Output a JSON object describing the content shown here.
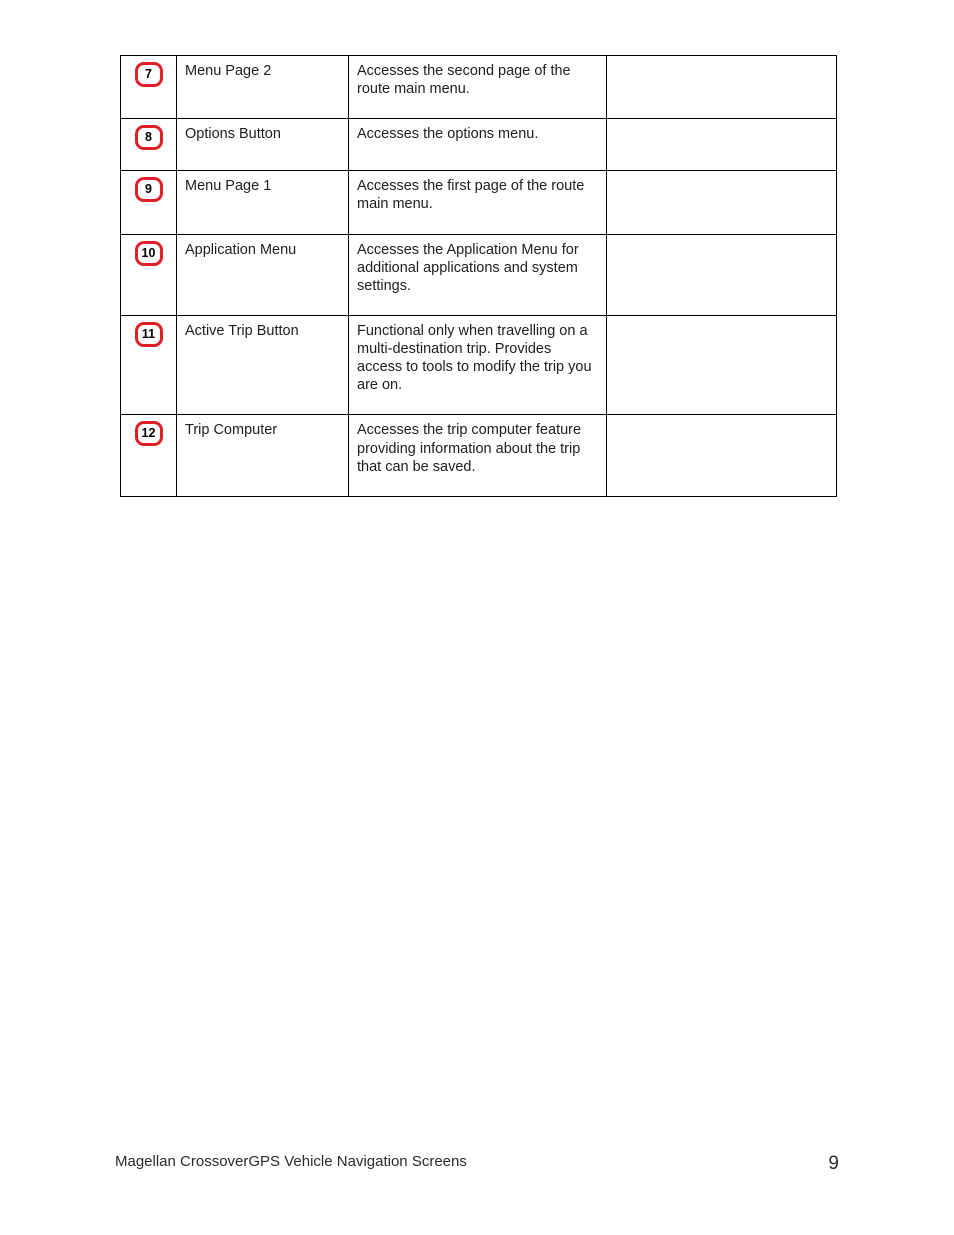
{
  "rows": [
    {
      "num": "7",
      "name": "Menu Page 2",
      "desc": "Accesses the second page of the route main menu."
    },
    {
      "num": "8",
      "name": "Options Button",
      "desc": "Accesses the options menu."
    },
    {
      "num": "9",
      "name": "Menu Page 1",
      "desc": "Accesses the first page of the route main menu."
    },
    {
      "num": "10",
      "name": "Application Menu",
      "desc": "Accesses the Application Menu for additional applications and system settings."
    },
    {
      "num": "11",
      "name": "Active Trip Button",
      "desc": "Functional only when travelling on a multi-destination trip. Provides access to tools to modify the trip you are on."
    },
    {
      "num": "12",
      "name": "Trip Computer",
      "desc": "Accesses the trip computer feature providing information about the trip that can be saved."
    }
  ],
  "footer": {
    "title": "Magellan CrossoverGPS Vehicle Navigation Screens",
    "page": "9"
  }
}
